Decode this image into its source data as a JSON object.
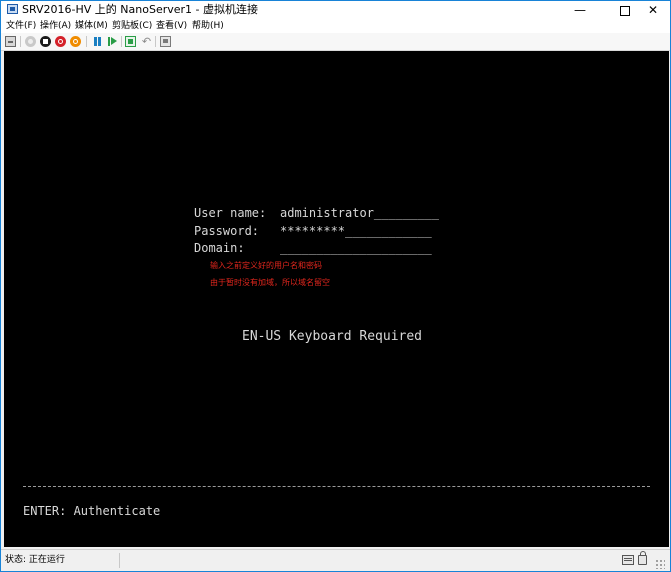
{
  "window": {
    "title": "SRV2016-HV 上的 NanoServer1 - 虚拟机连接",
    "controls": {
      "minimize": "—",
      "maximize": "",
      "close": "✕"
    }
  },
  "menu": {
    "items": [
      "文件(F)",
      "操作(A)",
      "媒体(M)",
      "剪贴板(C)",
      "查看(V)",
      "帮助(H)"
    ]
  },
  "toolbar": {
    "icons": [
      "ctrl-alt-del-icon",
      "start-icon",
      "turn-off-icon",
      "shut-down-icon",
      "save-icon",
      "pause-icon",
      "reset-icon",
      "checkpoint-icon",
      "revert-icon",
      "enhanced-session-icon"
    ],
    "revert_glyph": "↶"
  },
  "console": {
    "username_label": "User name:",
    "username_value": "administrator_________",
    "password_label": "Password:",
    "password_value": "*********____________",
    "domain_label": "Domain:",
    "domain_value": "_____________________",
    "annotations": [
      "输入之前定义好的用户名和密码",
      "由于暂时没有加域，所以域名留空"
    ],
    "keyboard_notice": "EN-US Keyboard Required",
    "footer_action": "ENTER: Authenticate"
  },
  "statusbar": {
    "status": "状态: 正在运行"
  },
  "colors": {
    "console_bg": "#000000",
    "console_text": "#d8d8d8",
    "annotation": "#e0261d",
    "window_border": "#1883d7"
  }
}
